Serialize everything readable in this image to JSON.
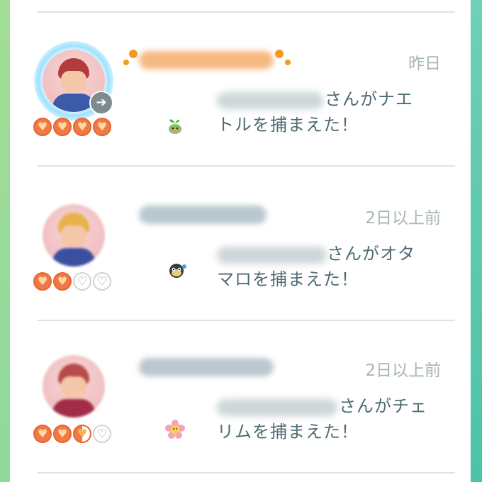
{
  "feed": {
    "entries": [
      {
        "trainer_name": "",
        "time": "昨日",
        "message_line1": "さんがナエ",
        "message_line2": "トルを捕まえた！",
        "pokemon_icon": "turtwig-icon",
        "friendship_hearts": [
          "full",
          "full",
          "full",
          "full"
        ],
        "name_color": "#f5a35a",
        "avatar_hair": "#b23c3c",
        "avatar_body": "#3b5aa8"
      },
      {
        "trainer_name": "",
        "time": "2日以上前",
        "message_line1": "さんがオタ",
        "message_line2": "マロを捕まえた！",
        "pokemon_icon": "tympole-icon",
        "friendship_hearts": [
          "full",
          "full",
          "empty",
          "empty"
        ],
        "name_color": "#9fb0b6",
        "avatar_hair": "#e8b24a",
        "avatar_body": "#3b4fa0"
      },
      {
        "trainer_name": "",
        "time": "2日以上前",
        "message_line1": "さんがチェ",
        "message_line2": "リムを捕まえた！",
        "pokemon_icon": "cherrim-icon",
        "friendship_hearts": [
          "full",
          "full",
          "half",
          "empty"
        ],
        "name_color": "#9fb0b6",
        "avatar_hair": "#b84a4a",
        "avatar_body": "#a02c46"
      }
    ]
  },
  "colors": {
    "accent_orange": "#f07a47",
    "text_message": "#4f6a72",
    "text_time": "#a8b4b8",
    "divider": "#dfe3e4"
  }
}
